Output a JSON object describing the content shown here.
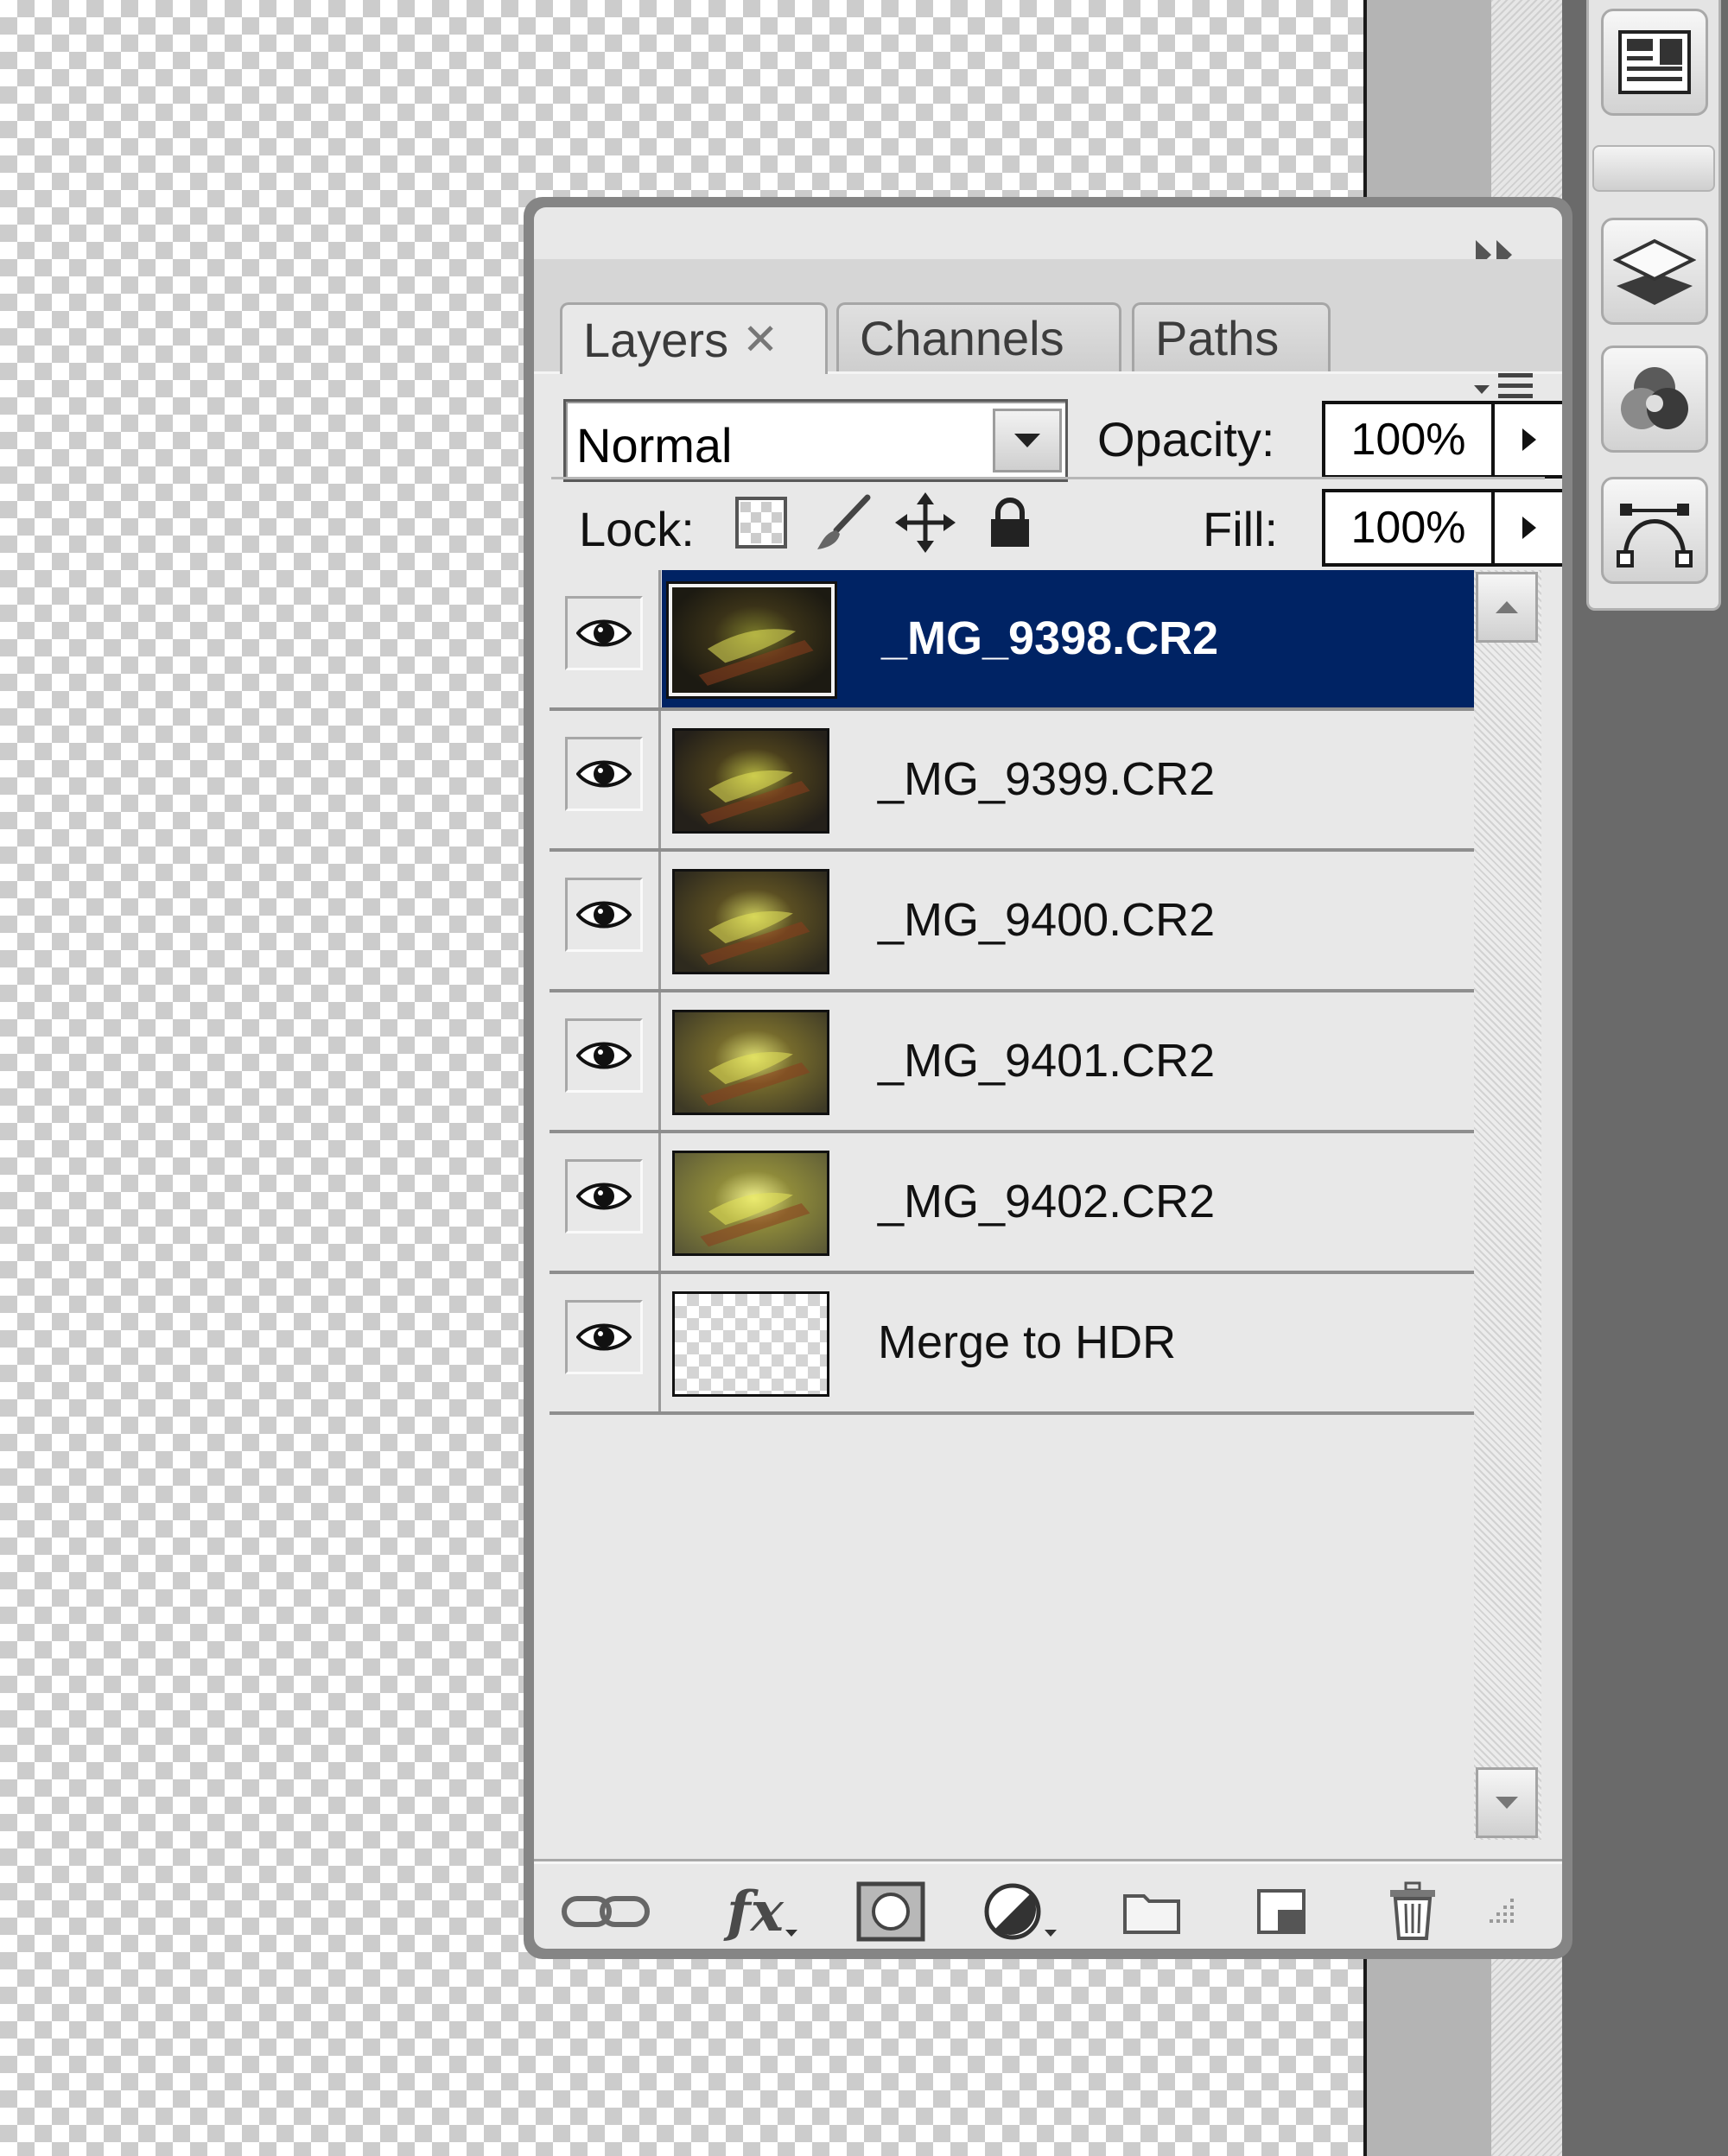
{
  "panel": {
    "tabs": [
      {
        "label": "Layers",
        "active": true
      },
      {
        "label": "Channels",
        "active": false
      },
      {
        "label": "Paths",
        "active": false
      }
    ]
  },
  "blend_mode": {
    "value": "Normal"
  },
  "opacity": {
    "label": "Opacity:",
    "value": "100%"
  },
  "lock": {
    "label": "Lock:"
  },
  "fill": {
    "label": "Fill:",
    "value": "100%"
  },
  "layers": [
    {
      "name": "_MG_9398.CR2",
      "selected": true,
      "visible": true,
      "thumb": "dark"
    },
    {
      "name": "_MG_9399.CR2",
      "selected": false,
      "visible": true,
      "thumb": "darkish"
    },
    {
      "name": "_MG_9400.CR2",
      "selected": false,
      "visible": true,
      "thumb": "mid"
    },
    {
      "name": "_MG_9401.CR2",
      "selected": false,
      "visible": true,
      "thumb": "midbright"
    },
    {
      "name": "_MG_9402.CR2",
      "selected": false,
      "visible": true,
      "thumb": "bright"
    },
    {
      "name": "Merge to HDR",
      "selected": false,
      "visible": true,
      "thumb": "transparent"
    }
  ],
  "colors": {
    "selection": "#002364",
    "panel_bg": "#e8e8e8"
  }
}
